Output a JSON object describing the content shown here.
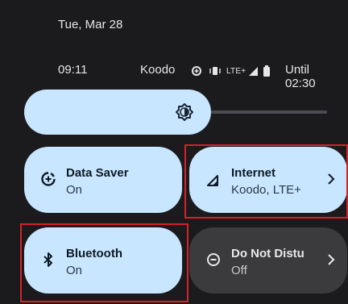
{
  "header": {
    "date": "Tue, Mar 28",
    "time": "09:11",
    "carrier": "Koodo",
    "network_type": "LTE+",
    "battery_status": "Until 02:30"
  },
  "brightness": {
    "icon": "brightness-icon"
  },
  "tiles": [
    {
      "label": "Data Saver",
      "status": "On",
      "icon": "data-saver-icon",
      "state": "on"
    },
    {
      "label": "Internet",
      "status": "Koodo, LTE+",
      "icon": "signal-icon",
      "state": "on"
    },
    {
      "label": "Bluetooth",
      "status": "On",
      "icon": "bluetooth-icon",
      "state": "on"
    },
    {
      "label": "Do Not Distu",
      "status": "Off",
      "icon": "dnd-icon",
      "state": "off"
    }
  ],
  "colors": {
    "tile_on": "#c8e6ff",
    "tile_off": "#3b3b3e",
    "background": "#1b1b1d",
    "highlight": "#d6202a"
  }
}
